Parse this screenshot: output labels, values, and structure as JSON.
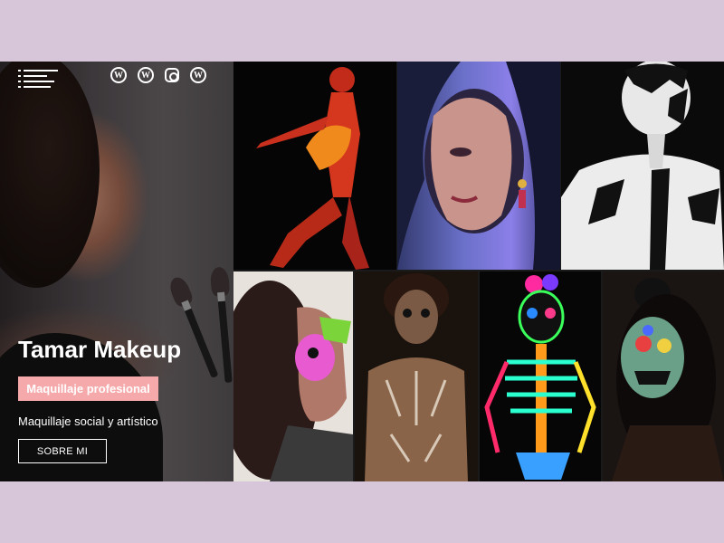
{
  "hero": {
    "brand": "Tamar Makeup",
    "tag": "Maquillaje profesional",
    "subtitle": "Maquillaje social y artístico",
    "cta": "SOBRE MI"
  },
  "social_icons": [
    "wordpress-icon",
    "wordpress-icon",
    "instagram-icon",
    "wordpress-icon"
  ],
  "colors": {
    "background": "#d7c5d9",
    "tag": "#f6a9aa",
    "text": "#ffffff"
  }
}
